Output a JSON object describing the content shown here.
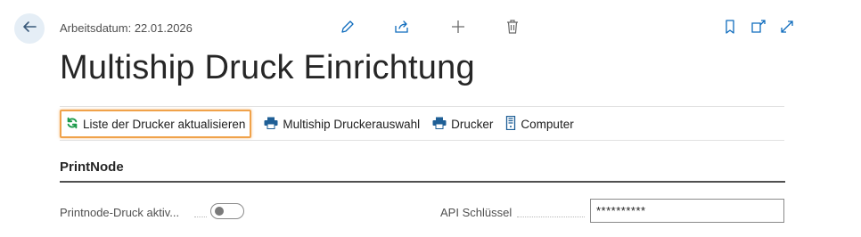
{
  "header": {
    "workdate_text": "Arbeitsdatum: 22.01.2026",
    "title": "Multiship Druck Einrichtung"
  },
  "actions": [
    {
      "label": "Liste der Drucker aktualisieren",
      "icon": "refresh-icon"
    },
    {
      "label": "Multiship Druckerauswahl",
      "icon": "printer-icon"
    },
    {
      "label": "Drucker",
      "icon": "printer-icon"
    },
    {
      "label": "Computer",
      "icon": "computer-icon"
    }
  ],
  "section": {
    "title": "PrintNode",
    "fields": {
      "printnode_label": "Printnode-Druck aktiv...",
      "printnode_enabled": false,
      "api_key_label": "API Schlüssel",
      "api_key_value": "**********"
    }
  },
  "colors": {
    "accent": "#0f6cbd",
    "refresh_icon": "#1b9a4a",
    "highlight_border": "#f0a24a",
    "back_button_bg": "#e5eef6"
  }
}
